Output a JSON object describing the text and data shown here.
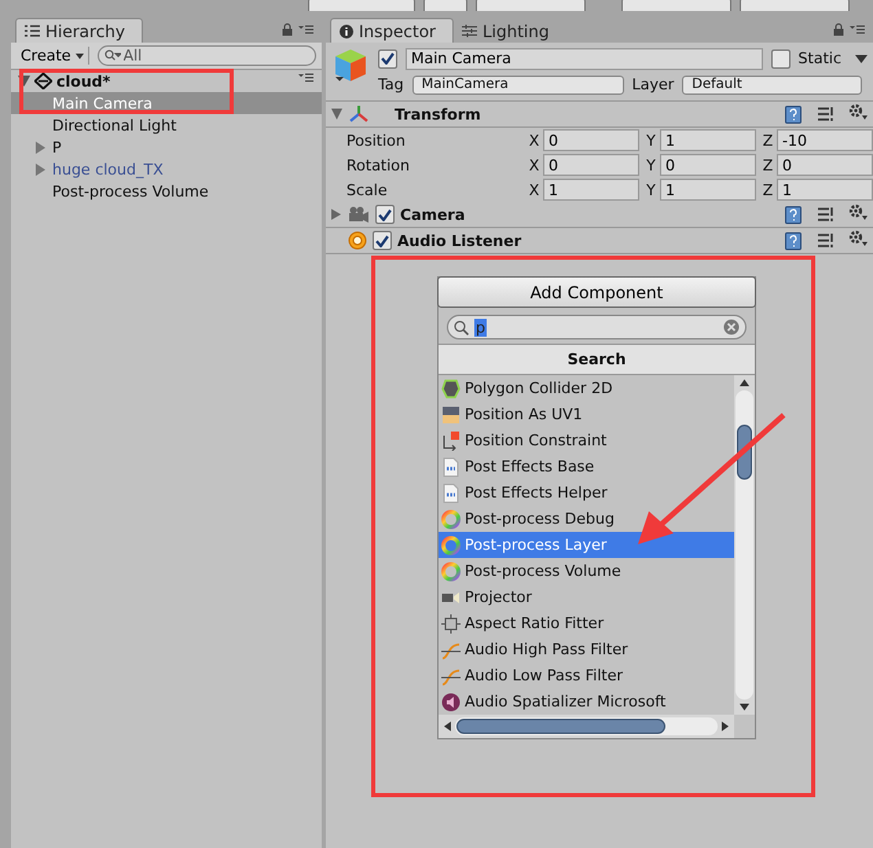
{
  "hierarchy": {
    "tab": "Hierarchy",
    "create": "Create",
    "search_placeholder": "All",
    "scene": {
      "name": "cloud*",
      "expanded": true
    },
    "items": [
      {
        "label": "Main Camera",
        "kind": "object",
        "prefab": false,
        "selected": true
      },
      {
        "label": "Directional Light",
        "kind": "object",
        "prefab": false,
        "selected": false
      },
      {
        "label": "P",
        "kind": "parent",
        "prefab": false,
        "selected": false
      },
      {
        "label": "huge cloud_TX",
        "kind": "parent",
        "prefab": true,
        "selected": false
      },
      {
        "label": "Post-process Volume",
        "kind": "object",
        "prefab": false,
        "selected": false
      }
    ]
  },
  "inspector": {
    "tabs": [
      {
        "label": "Inspector",
        "selected": true
      },
      {
        "label": "Lighting",
        "selected": false
      }
    ],
    "object": {
      "active": true,
      "name": "Main Camera",
      "static_label": "Static",
      "static": false,
      "tag_label": "Tag",
      "tag": "MainCamera",
      "layer_label": "Layer",
      "layer": "Default"
    },
    "components": [
      {
        "name": "Transform",
        "kind": "transform",
        "expanded": true,
        "rows": [
          {
            "label": "Position",
            "fields": [
              {
                "axis": "X",
                "value": "0"
              },
              {
                "axis": "Y",
                "value": "1"
              },
              {
                "axis": "Z",
                "value": "-10"
              }
            ]
          },
          {
            "label": "Rotation",
            "fields": [
              {
                "axis": "X",
                "value": "0"
              },
              {
                "axis": "Y",
                "value": "0"
              },
              {
                "axis": "Z",
                "value": "0"
              }
            ]
          },
          {
            "label": "Scale",
            "fields": [
              {
                "axis": "X",
                "value": "1"
              },
              {
                "axis": "Y",
                "value": "1"
              },
              {
                "axis": "Z",
                "value": "1"
              }
            ]
          }
        ]
      },
      {
        "name": "Camera",
        "kind": "camera",
        "expanded": false,
        "enabled": true
      },
      {
        "name": "Audio Listener",
        "kind": "audio",
        "enabled": true
      }
    ]
  },
  "add_component": {
    "button": "Add Component",
    "search_value": "p",
    "header": "Search",
    "items": [
      {
        "label": "Polygon Collider 2D",
        "kind": "collider",
        "selected": false
      },
      {
        "label": "Position As UV1",
        "kind": "uv",
        "selected": false
      },
      {
        "label": "Position Constraint",
        "kind": "constraint",
        "selected": false
      },
      {
        "label": "Post Effects Base",
        "kind": "script",
        "selected": false
      },
      {
        "label": "Post Effects Helper",
        "kind": "script",
        "selected": false
      },
      {
        "label": "Post-process Debug",
        "kind": "postprocess",
        "selected": false
      },
      {
        "label": "Post-process Layer",
        "kind": "postprocess",
        "selected": true
      },
      {
        "label": "Post-process Volume",
        "kind": "postprocess",
        "selected": false
      },
      {
        "label": "Projector",
        "kind": "projector",
        "selected": false
      },
      {
        "label": "Aspect Ratio Fitter",
        "kind": "aspect",
        "selected": false
      },
      {
        "label": "Audio High Pass Filter",
        "kind": "filter",
        "selected": false
      },
      {
        "label": "Audio Low Pass Filter",
        "kind": "filter",
        "selected": false
      },
      {
        "label": "Audio Spatializer Microsoft",
        "kind": "spatializer",
        "selected": false
      }
    ]
  }
}
